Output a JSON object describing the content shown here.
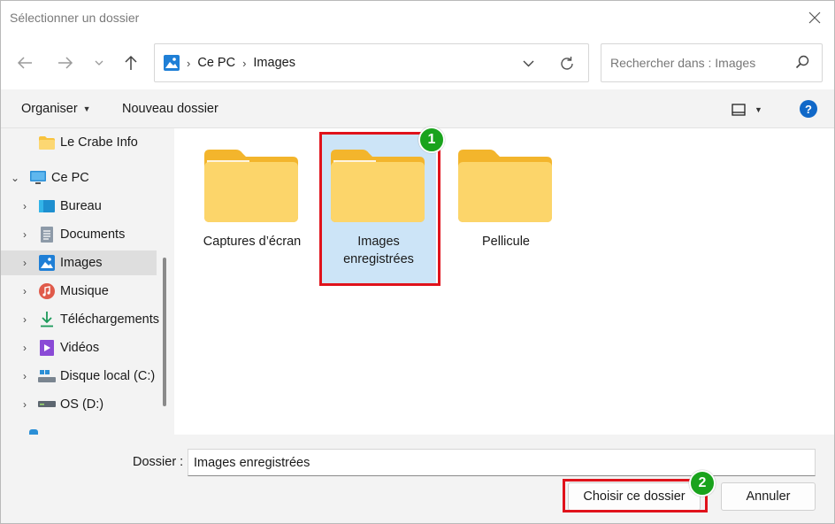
{
  "window": {
    "title": "Sélectionner un dossier"
  },
  "nav": {
    "breadcrumb": [
      "Ce PC",
      "Images"
    ],
    "search_placeholder": "Rechercher dans : Images"
  },
  "commands": {
    "organize": "Organiser",
    "new_folder": "Nouveau dossier",
    "help": "?"
  },
  "sidebar": {
    "items": [
      {
        "label": "Le Crabe Info",
        "icon": "folder-icon"
      },
      {
        "label": "Ce PC",
        "icon": "computer-icon"
      },
      {
        "label": "Bureau",
        "icon": "desktop-icon"
      },
      {
        "label": "Documents",
        "icon": "documents-icon"
      },
      {
        "label": "Images",
        "icon": "pictures-icon"
      },
      {
        "label": "Musique",
        "icon": "music-icon"
      },
      {
        "label": "Téléchargements",
        "icon": "download-icon"
      },
      {
        "label": "Vidéos",
        "icon": "video-icon"
      },
      {
        "label": "Disque local (C:)",
        "icon": "local-disk-icon"
      },
      {
        "label": "OS (D:)",
        "icon": "drive-icon"
      }
    ]
  },
  "folders": [
    {
      "name": "Captures d’écran"
    },
    {
      "name": "Images enregistrées"
    },
    {
      "name": "Pellicule"
    }
  ],
  "annotations": {
    "step1": "1",
    "step2": "2",
    "highlight_color": "#e0121b",
    "badge_color": "#1aa31d"
  },
  "footer": {
    "folder_label": "Dossier :",
    "folder_value": "Images enregistrées",
    "choose_button": "Choisir ce dossier",
    "cancel_button": "Annuler"
  },
  "colors": {
    "accent": "#1068c8",
    "selection": "#cce4f7",
    "folder_yellow": "#f8c33e"
  }
}
